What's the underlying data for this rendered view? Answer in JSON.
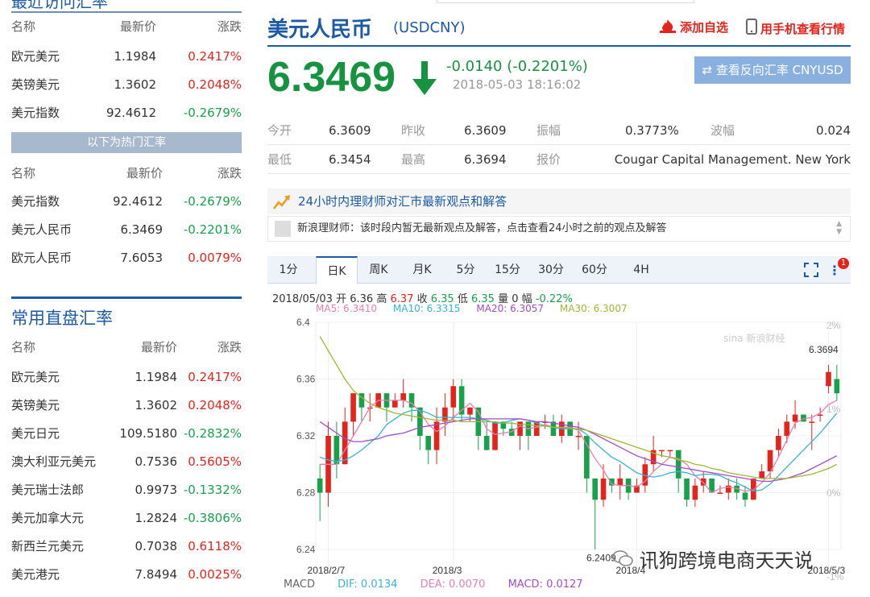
{
  "left": {
    "top_title": "最近访问汇率",
    "headers": [
      "名称",
      "最新价",
      "涨跌"
    ],
    "recent": [
      {
        "name": "欧元美元",
        "price": "1.1984",
        "change": "0.2417%",
        "dir": "up"
      },
      {
        "name": "英镑美元",
        "price": "1.3602",
        "change": "0.2048%",
        "dir": "up"
      },
      {
        "name": "美元指数",
        "price": "92.4612",
        "change": "-0.2679%",
        "dir": "down"
      }
    ],
    "hot_label": "以下为热门汇率",
    "hot": [
      {
        "name": "美元指数",
        "price": "92.4612",
        "change": "-0.2679%",
        "dir": "down"
      },
      {
        "name": "美元人民币",
        "price": "6.3469",
        "change": "-0.2201%",
        "dir": "down"
      },
      {
        "name": "欧元人民币",
        "price": "7.6053",
        "change": "0.0079%",
        "dir": "up"
      }
    ],
    "direct_title": "常用直盘汇率",
    "direct": [
      {
        "name": "欧元美元",
        "price": "1.1984",
        "change": "0.2417%",
        "dir": "up"
      },
      {
        "name": "英镑美元",
        "price": "1.3602",
        "change": "0.2048%",
        "dir": "up"
      },
      {
        "name": "美元日元",
        "price": "109.5180",
        "change": "-0.2832%",
        "dir": "down"
      },
      {
        "name": "澳大利亚元美元",
        "price": "0.7536",
        "change": "0.5605%",
        "dir": "up"
      },
      {
        "name": "美元瑞士法郎",
        "price": "0.9973",
        "change": "-0.1332%",
        "dir": "down"
      },
      {
        "name": "美元加拿大元",
        "price": "1.2824",
        "change": "-0.3806%",
        "dir": "down"
      },
      {
        "name": "新西兰元美元",
        "price": "0.7038",
        "change": "0.6118%",
        "dir": "up"
      },
      {
        "name": "美元港元",
        "price": "7.8494",
        "change": "0.0025%",
        "dir": "up"
      }
    ]
  },
  "quote": {
    "title": "美元人民币",
    "code": "(USDCNY)",
    "add_watch": "添加自选",
    "mobile": "用手机查看行情",
    "price": "6.3469",
    "change": "-0.0140 (-0.2201%)",
    "time": "2018-05-03 18:16:02",
    "reverse": "查看反向汇率 CNYUSD",
    "stats": {
      "open_label": "今开",
      "open": "6.3609",
      "prev_label": "昨收",
      "prev": "6.3609",
      "amp_label": "振幅",
      "amp": "0.3773%",
      "wave_label": "波幅",
      "wave": "0.024",
      "low_label": "最低",
      "low": "6.3454",
      "high_label": "最高",
      "high": "6.3694",
      "quote_label": "报价",
      "quoter": "Cougar Capital Management. New York"
    }
  },
  "opinion": {
    "title": "24小时内理财师对汇市最新观点和解答",
    "message": "新浪理财师：该时段内暂无最新观点及解答，点击查看24小时之前的观点及解答"
  },
  "tabs": [
    "1分",
    "日K",
    "周K",
    "月K",
    "5分",
    "15分",
    "30分",
    "60分",
    "4H"
  ],
  "active_tab": 1,
  "notif_count": "1",
  "chart_info": {
    "date": "2018/05/03",
    "open_label": "开",
    "open": "6.36",
    "high_label": "高",
    "high": "6.37",
    "close_label": "收",
    "close": "6.35",
    "low_label": "低",
    "low": "6.35",
    "vol_label": "量",
    "vol": "0",
    "range_label": "幅",
    "range": "-0.22%",
    "ma5": "MA5: 6.3410",
    "ma10": "MA10: 6.3315",
    "ma20": "MA20: 6.3057",
    "ma30": "MA30: 6.3007"
  },
  "chart_data": {
    "type": "candlestick",
    "y_ticks": [
      "6.4",
      "6.36",
      "6.32",
      "6.28",
      "6.24"
    ],
    "ylim": [
      6.24,
      6.4
    ],
    "right_ticks": [
      "2%",
      "1%",
      "0%",
      "-1%"
    ],
    "x_ticks": [
      {
        "label": "2018/2/7",
        "index": 1
      },
      {
        "label": "2018/3",
        "index": 16
      },
      {
        "label": "2018/4",
        "index": 38
      },
      {
        "label": "2018/5/3",
        "index": 61
      }
    ],
    "max_label": "6.3694",
    "min_label": "6.2409",
    "candles": [
      {
        "o": 6.29,
        "c": 6.28,
        "h": 6.3,
        "l": 6.26
      },
      {
        "o": 6.28,
        "c": 6.32,
        "h": 6.33,
        "l": 6.27
      },
      {
        "o": 6.32,
        "c": 6.3,
        "h": 6.33,
        "l": 6.29
      },
      {
        "o": 6.3,
        "c": 6.33,
        "h": 6.34,
        "l": 6.3
      },
      {
        "o": 6.33,
        "c": 6.35,
        "h": 6.35,
        "l": 6.32
      },
      {
        "o": 6.35,
        "c": 6.34,
        "h": 6.35,
        "l": 6.33
      },
      {
        "o": 6.34,
        "c": 6.34,
        "h": 6.35,
        "l": 6.33
      },
      {
        "o": 6.34,
        "c": 6.35,
        "h": 6.35,
        "l": 6.34
      },
      {
        "o": 6.35,
        "c": 6.34,
        "h": 6.35,
        "l": 6.33
      },
      {
        "o": 6.34,
        "c": 6.345,
        "h": 6.35,
        "l": 6.34
      },
      {
        "o": 6.345,
        "c": 6.35,
        "h": 6.36,
        "l": 6.34
      },
      {
        "o": 6.35,
        "c": 6.34,
        "h": 6.35,
        "l": 6.33
      },
      {
        "o": 6.34,
        "c": 6.32,
        "h": 6.34,
        "l": 6.31
      },
      {
        "o": 6.32,
        "c": 6.31,
        "h": 6.32,
        "l": 6.3
      },
      {
        "o": 6.31,
        "c": 6.33,
        "h": 6.34,
        "l": 6.3
      },
      {
        "o": 6.33,
        "c": 6.34,
        "h": 6.35,
        "l": 6.32
      },
      {
        "o": 6.34,
        "c": 6.355,
        "h": 6.36,
        "l": 6.33
      },
      {
        "o": 6.355,
        "c": 6.335,
        "h": 6.36,
        "l": 6.33
      },
      {
        "o": 6.335,
        "c": 6.34,
        "h": 6.34,
        "l": 6.33
      },
      {
        "o": 6.34,
        "c": 6.32,
        "h": 6.34,
        "l": 6.31
      },
      {
        "o": 6.32,
        "c": 6.31,
        "h": 6.33,
        "l": 6.31
      },
      {
        "o": 6.31,
        "c": 6.33,
        "h": 6.33,
        "l": 6.31
      },
      {
        "o": 6.33,
        "c": 6.325,
        "h": 6.33,
        "l": 6.32
      },
      {
        "o": 6.325,
        "c": 6.32,
        "h": 6.33,
        "l": 6.32
      },
      {
        "o": 6.32,
        "c": 6.33,
        "h": 6.33,
        "l": 6.31
      },
      {
        "o": 6.33,
        "c": 6.32,
        "h": 6.33,
        "l": 6.31
      },
      {
        "o": 6.32,
        "c": 6.33,
        "h": 6.33,
        "l": 6.32
      },
      {
        "o": 6.33,
        "c": 6.33,
        "h": 6.335,
        "l": 6.325
      },
      {
        "o": 6.33,
        "c": 6.32,
        "h": 6.335,
        "l": 6.32
      },
      {
        "o": 6.32,
        "c": 6.33,
        "h": 6.335,
        "l": 6.315
      },
      {
        "o": 6.33,
        "c": 6.32,
        "h": 6.33,
        "l": 6.32
      },
      {
        "o": 6.32,
        "c": 6.32,
        "h": 6.33,
        "l": 6.31
      },
      {
        "o": 6.32,
        "c": 6.29,
        "h": 6.32,
        "l": 6.28
      },
      {
        "o": 6.29,
        "c": 6.275,
        "h": 6.29,
        "l": 6.24
      },
      {
        "o": 6.275,
        "c": 6.29,
        "h": 6.3,
        "l": 6.27
      },
      {
        "o": 6.29,
        "c": 6.285,
        "h": 6.29,
        "l": 6.28
      },
      {
        "o": 6.285,
        "c": 6.29,
        "h": 6.3,
        "l": 6.275
      },
      {
        "o": 6.29,
        "c": 6.28,
        "h": 6.29,
        "l": 6.275
      },
      {
        "o": 6.28,
        "c": 6.285,
        "h": 6.29,
        "l": 6.28
      },
      {
        "o": 6.285,
        "c": 6.3,
        "h": 6.305,
        "l": 6.28
      },
      {
        "o": 6.3,
        "c": 6.31,
        "h": 6.32,
        "l": 6.295
      },
      {
        "o": 6.31,
        "c": 6.31,
        "h": 6.31,
        "l": 6.305
      },
      {
        "o": 6.31,
        "c": 6.31,
        "h": 6.31,
        "l": 6.305
      },
      {
        "o": 6.31,
        "c": 6.29,
        "h": 6.31,
        "l": 6.28
      },
      {
        "o": 6.29,
        "c": 6.275,
        "h": 6.29,
        "l": 6.27
      },
      {
        "o": 6.275,
        "c": 6.285,
        "h": 6.29,
        "l": 6.27
      },
      {
        "o": 6.285,
        "c": 6.29,
        "h": 6.295,
        "l": 6.28
      },
      {
        "o": 6.29,
        "c": 6.28,
        "h": 6.29,
        "l": 6.28
      },
      {
        "o": 6.28,
        "c": 6.28,
        "h": 6.285,
        "l": 6.28
      },
      {
        "o": 6.28,
        "c": 6.285,
        "h": 6.29,
        "l": 6.275
      },
      {
        "o": 6.285,
        "c": 6.28,
        "h": 6.29,
        "l": 6.275
      },
      {
        "o": 6.28,
        "c": 6.275,
        "h": 6.285,
        "l": 6.27
      },
      {
        "o": 6.275,
        "c": 6.29,
        "h": 6.29,
        "l": 6.275
      },
      {
        "o": 6.29,
        "c": 6.295,
        "h": 6.3,
        "l": 6.29
      },
      {
        "o": 6.295,
        "c": 6.31,
        "h": 6.31,
        "l": 6.29
      },
      {
        "o": 6.31,
        "c": 6.32,
        "h": 6.325,
        "l": 6.305
      },
      {
        "o": 6.32,
        "c": 6.33,
        "h": 6.335,
        "l": 6.315
      },
      {
        "o": 6.33,
        "c": 6.335,
        "h": 6.345,
        "l": 6.325
      },
      {
        "o": 6.335,
        "c": 6.33,
        "h": 6.335,
        "l": 6.33
      },
      {
        "o": 6.33,
        "c": 6.33,
        "h": 6.335,
        "l": 6.31
      },
      {
        "o": 6.335,
        "c": 6.335,
        "h": 6.34,
        "l": 6.33
      },
      {
        "o": 6.355,
        "c": 6.365,
        "h": 6.37,
        "l": 6.35
      },
      {
        "o": 6.36,
        "c": 6.35,
        "h": 6.37,
        "l": 6.345
      }
    ],
    "series": [
      {
        "key": "ma5",
        "color": "#e97fb0",
        "values": [
          6.3,
          6.3,
          6.3,
          6.31,
          6.32,
          6.33,
          6.34,
          6.345,
          6.345,
          6.345,
          6.345,
          6.343,
          6.337,
          6.328,
          6.323,
          6.327,
          6.333,
          6.338,
          6.343,
          6.337,
          6.325,
          6.321,
          6.322,
          6.323,
          6.327,
          6.325,
          6.326,
          6.328,
          6.326,
          6.326,
          6.326,
          6.324,
          6.314,
          6.304,
          6.296,
          6.286,
          6.285,
          6.285,
          6.284,
          6.288,
          6.295,
          6.3,
          6.305,
          6.304,
          6.3,
          6.292,
          6.287,
          6.28,
          6.283,
          6.284,
          6.283,
          6.281,
          6.282,
          6.287,
          6.294,
          6.305,
          6.317,
          6.329,
          6.332,
          6.333,
          6.336,
          6.342,
          6.345
        ]
      },
      {
        "key": "ma10",
        "color": "#34b5d8",
        "values": [
          6.305,
          6.303,
          6.302,
          6.303,
          6.306,
          6.31,
          6.315,
          6.32,
          6.328,
          6.332,
          6.336,
          6.338,
          6.338,
          6.336,
          6.333,
          6.333,
          6.333,
          6.333,
          6.333,
          6.332,
          6.331,
          6.329,
          6.329,
          6.331,
          6.332,
          6.331,
          6.329,
          6.327,
          6.326,
          6.325,
          6.325,
          6.325,
          6.321,
          6.315,
          6.31,
          6.305,
          6.302,
          6.298,
          6.294,
          6.292,
          6.291,
          6.292,
          6.294,
          6.295,
          6.294,
          6.292,
          6.293,
          6.293,
          6.292,
          6.289,
          6.287,
          6.284,
          6.281,
          6.282,
          6.286,
          6.292,
          6.298,
          6.304,
          6.31,
          6.316,
          6.322,
          6.329,
          6.336
        ]
      },
      {
        "key": "ma20",
        "color": "#a44cc8",
        "values": [
          6.33,
          6.326,
          6.322,
          6.318,
          6.316,
          6.316,
          6.317,
          6.318,
          6.32,
          6.321,
          6.322,
          6.324,
          6.326,
          6.327,
          6.328,
          6.329,
          6.33,
          6.331,
          6.332,
          6.332,
          6.332,
          6.332,
          6.332,
          6.332,
          6.332,
          6.331,
          6.33,
          6.33,
          6.329,
          6.328,
          6.327,
          6.326,
          6.324,
          6.321,
          6.318,
          6.315,
          6.312,
          6.309,
          6.306,
          6.304,
          6.302,
          6.3,
          6.299,
          6.298,
          6.297,
          6.296,
          6.295,
          6.294,
          6.293,
          6.292,
          6.291,
          6.29,
          6.289,
          6.288,
          6.288,
          6.289,
          6.29,
          6.292,
          6.294,
          6.297,
          6.3,
          6.303,
          6.306
        ]
      },
      {
        "key": "ma30",
        "color": "#9fb631",
        "values": [
          6.39,
          6.38,
          6.37,
          6.36,
          6.352,
          6.347,
          6.343,
          6.34,
          6.338,
          6.336,
          6.335,
          6.334,
          6.333,
          6.332,
          6.331,
          6.331,
          6.331,
          6.33,
          6.33,
          6.33,
          6.33,
          6.33,
          6.329,
          6.329,
          6.328,
          6.328,
          6.327,
          6.327,
          6.326,
          6.326,
          6.325,
          6.325,
          6.324,
          6.322,
          6.32,
          6.318,
          6.316,
          6.314,
          6.312,
          6.31,
          6.308,
          6.306,
          6.305,
          6.303,
          6.302,
          6.3,
          6.299,
          6.297,
          6.296,
          6.294,
          6.293,
          6.292,
          6.291,
          6.29,
          6.29,
          6.29,
          6.29,
          6.291,
          6.292,
          6.293,
          6.295,
          6.297,
          6.3
        ]
      }
    ]
  },
  "macd": {
    "label": "MACD",
    "dif": "DIF: 0.0134",
    "dea": "DEA: 0.0070",
    "macd": "MACD: 0.0127"
  },
  "brand": {
    "sina": "sina 新浪财经",
    "watermark": "讯狗跨境电商天天说"
  },
  "colors": {
    "up": "#e2241b",
    "down": "#18a14b",
    "accent": "#1c5aa6"
  }
}
